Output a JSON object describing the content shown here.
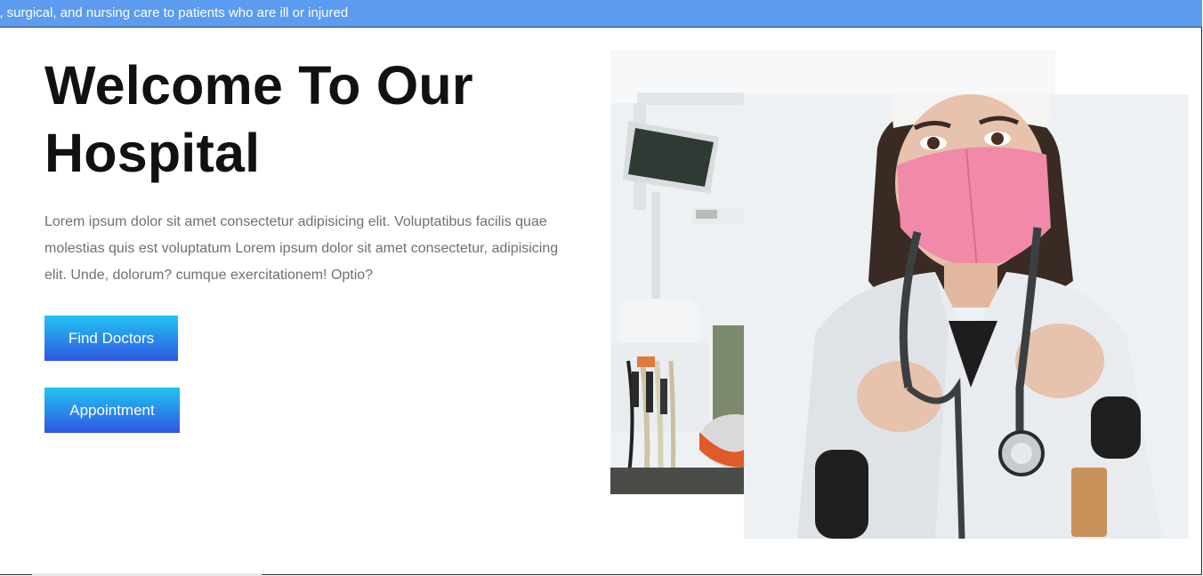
{
  "ticker": {
    "text": "l, surgical, and nursing care to patients who are ill or injured"
  },
  "hero": {
    "title_line1": "Welcome To Our",
    "title_line2": "Hospital",
    "description": "Lorem ipsum dolor sit amet consectetur adipisicing elit. Voluptatibus facilis quae molestias quis est voluptatum Lorem ipsum dolor sit amet consectetur, adipisicing elit. Unde, dolorum? cumque exercitationem! Optio?",
    "buttons": {
      "find_doctors": "Find Doctors",
      "appointment": "Appointment"
    }
  },
  "images": {
    "back": "dental-clinic-photo",
    "front": "nurse-with-mask-photo"
  },
  "colors": {
    "ticker_bg": "#5b9bf0",
    "button_gradient_top": "#22c4f2",
    "button_gradient_bottom": "#2f55e4",
    "title": "#111111",
    "body_text": "#707070",
    "mask": "#f08aa8"
  }
}
